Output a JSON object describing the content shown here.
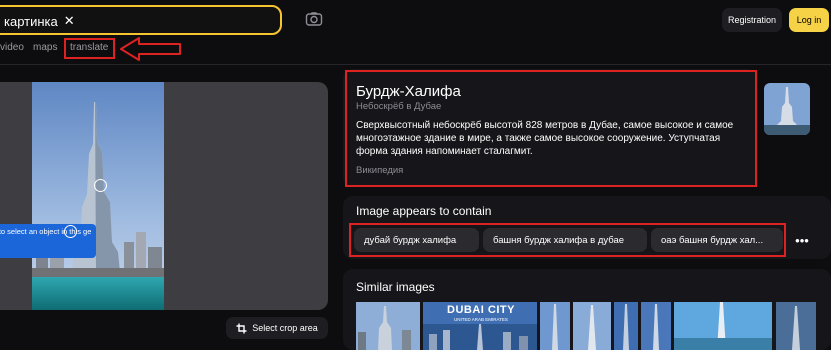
{
  "search": {
    "chip_label": "картинка",
    "clear_glyph": "✕"
  },
  "header": {
    "registration_label": "Registration",
    "login_label": "Log in"
  },
  "tabs": [
    {
      "label": "video"
    },
    {
      "label": "maps"
    },
    {
      "label": "translate"
    }
  ],
  "viewer": {
    "tooltip_text": "k to select an object in this ge",
    "crop_label": "Select crop area",
    "crop_icon": "crop-icon"
  },
  "wiki": {
    "title": "Бурдж-Халифа",
    "subtitle": "Небоскрёб в Дубае",
    "description": "Сверхвысотный небоскрёб высотой 828 метров в Дубае, самое высокое и самое многоэтажное здание в мире, а также самое высокое сооружение. Уступчатая форма здания напоминает сталагмит.",
    "source": "Википедия"
  },
  "contains": {
    "title": "Image appears to contain",
    "tags": [
      "дубай бурдж халифа",
      "башня бурдж халифа в дубае",
      "оаэ башня бурдж хал..."
    ],
    "more_glyph": "•••"
  },
  "similar": {
    "title": "Similar images",
    "dubai_caption": "DUBAI CITY",
    "dubai_subcaption": "UNITED ARAB EMIRATES"
  },
  "colors": {
    "accent": "#f6c431",
    "annotation_red": "#dd2222",
    "tooltip_blue": "#1b66d9"
  }
}
